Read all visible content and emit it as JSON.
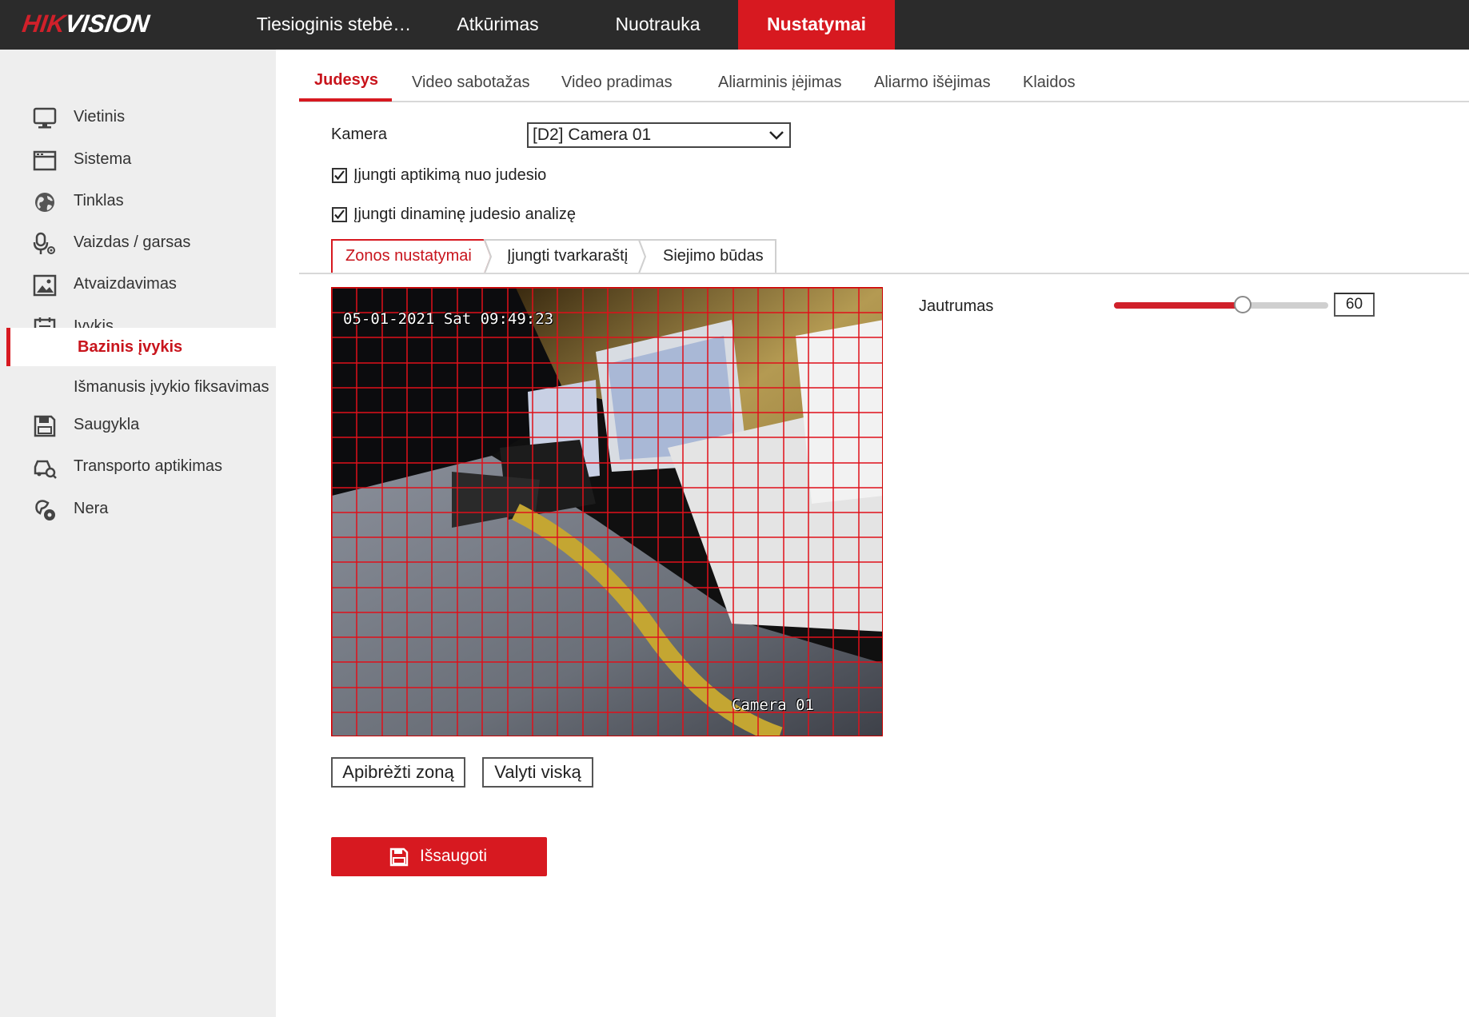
{
  "brand": {
    "part1": "HIK",
    "part2": "VISION",
    "color": "#d0202a"
  },
  "topnav": [
    {
      "label": "Tiesioginis stebė…"
    },
    {
      "label": "Atkūrimas"
    },
    {
      "label": "Nuotrauka"
    },
    {
      "label": "Nustatymai",
      "active": true
    }
  ],
  "sidebar": {
    "items": [
      {
        "label": "Vietinis",
        "icon": "monitor-icon"
      },
      {
        "label": "Sistema",
        "icon": "system-icon"
      },
      {
        "label": "Tinklas",
        "icon": "globe-icon"
      },
      {
        "label": "Vaizdas / garsas",
        "icon": "microphone-icon"
      },
      {
        "label": "Atvaizdavimas",
        "icon": "image-icon"
      },
      {
        "label": "Įvykis",
        "icon": "calendar-icon"
      },
      {
        "label": "Saugykla",
        "icon": "storage-icon"
      },
      {
        "label": "Transporto aptikimas",
        "icon": "vehicle-search-icon"
      },
      {
        "label": "Nera",
        "icon": "camera-settings-icon"
      }
    ],
    "sub_items": [
      {
        "label": "Bazinis įvykis",
        "active": true
      },
      {
        "label": "Išmanusis įvykio fiksavimas"
      }
    ]
  },
  "tabs": [
    {
      "label": "Judesys",
      "active": true
    },
    {
      "label": "Video sabotažas"
    },
    {
      "label": "Video pradimas"
    },
    {
      "label": "Aliarminis įėjimas"
    },
    {
      "label": "Aliarmo išėjimas"
    },
    {
      "label": "Klaidos"
    }
  ],
  "form": {
    "camera_label": "Kamera",
    "camera_value": "[D2] Camera 01",
    "enable_motion_label": "Įjungti aptikimą nuo judesio",
    "enable_motion_checked": true,
    "enable_dynamic_label": "Įjungti dinaminę judesio analizę",
    "enable_dynamic_checked": true
  },
  "steps": [
    {
      "label": "Zonos nustatymai",
      "active": true
    },
    {
      "label": "Įjungti tvarkaraštį"
    },
    {
      "label": "Siejimo būdas"
    }
  ],
  "video": {
    "osd_datetime": "05-01-2021 Sat 09:49:23",
    "osd_camera": "Camera 01",
    "grid_color": "#e0101a"
  },
  "sensitivity": {
    "label": "Jautrumas",
    "value": "60",
    "fraction": 0.6
  },
  "buttons": {
    "define_zone": "Apibrėžti zoną",
    "clear_all": "Valyti viską",
    "save": "Išsaugoti"
  },
  "colors": {
    "accent": "#d71920",
    "topbar": "#2b2b2b",
    "sidebar": "#eeeeee"
  }
}
